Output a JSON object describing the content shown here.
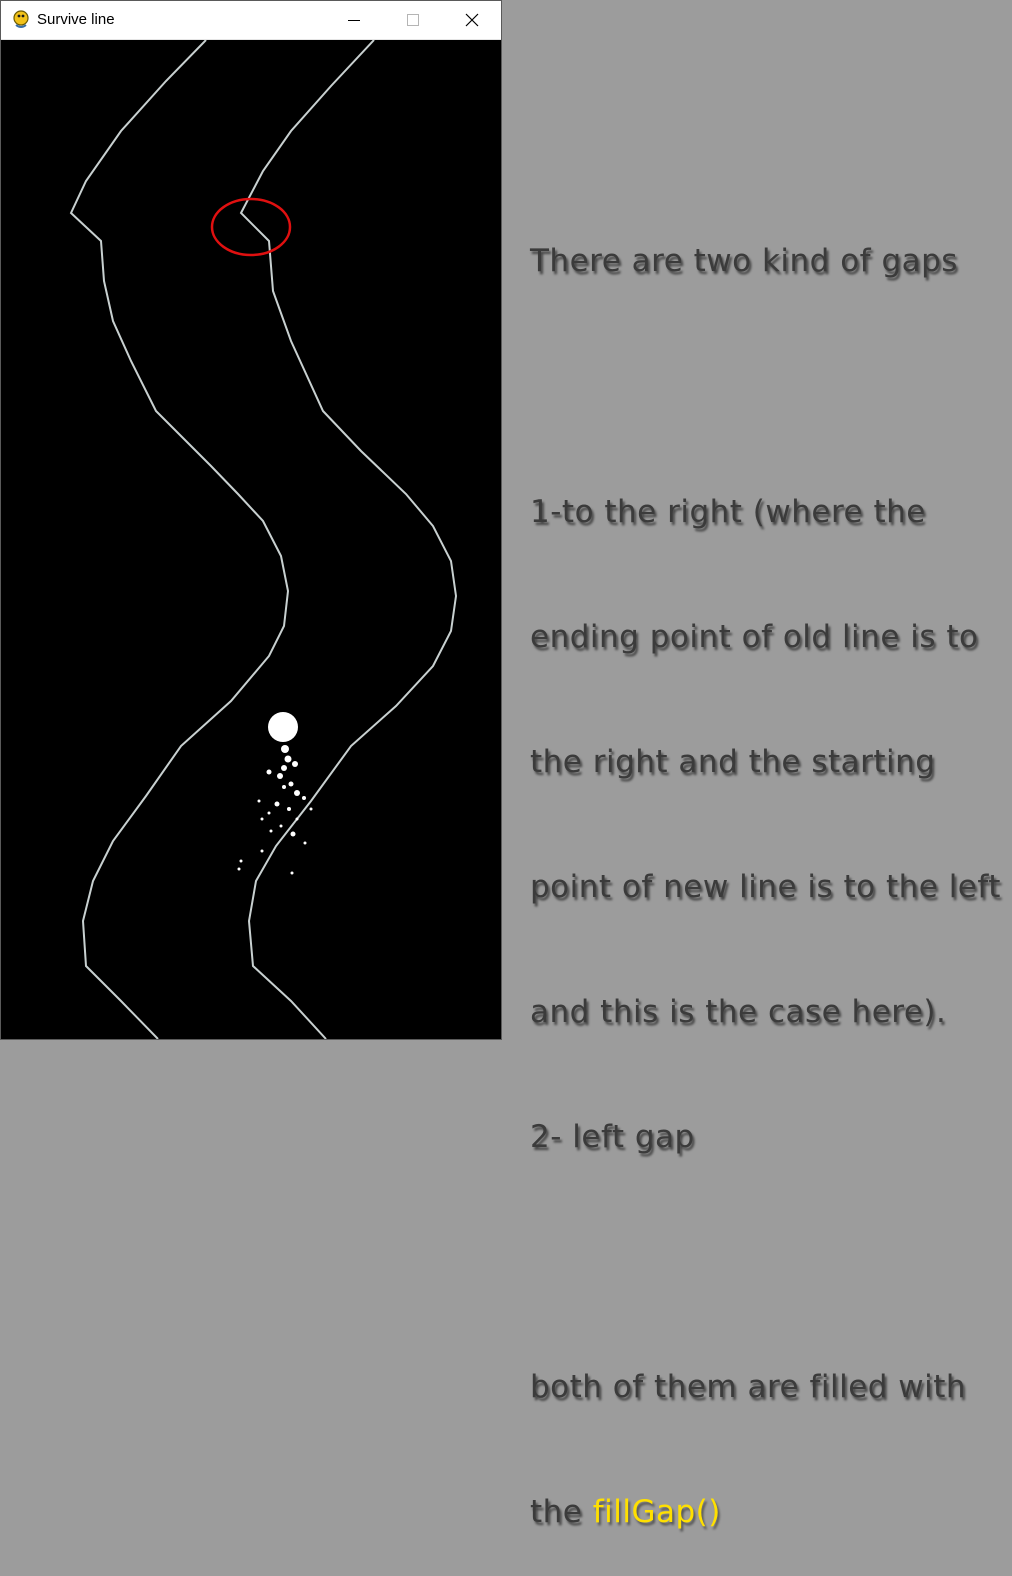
{
  "window": {
    "title": "Survive line",
    "minimize_icon": "minimize-icon",
    "maximize_icon": "maximize-icon",
    "close_icon": "close-icon",
    "app_icon": "pygame-snake-icon"
  },
  "colors": {
    "canvas_bg": "#000000",
    "track_line": "#c8d0d0",
    "highlight_circle": "#e01010",
    "ball": "#ffffff",
    "panel_bg": "#9c9c9c",
    "note_text": "#3b3b3b",
    "code_text": "#ffe000"
  },
  "annotation": {
    "line1": "There are two kind of gaps",
    "line2": "",
    "line3": "1-to the right (where the",
    "line4": "ending point of old line is to",
    "line5": "the right and the starting",
    "line6": "point of new line is to the left",
    "line7": "and this is the case here).",
    "line8": "2- left gap",
    "line9": "",
    "line10": "both of them are filled with",
    "line11_prefix": "the ",
    "line11_code": "fillGap()"
  }
}
